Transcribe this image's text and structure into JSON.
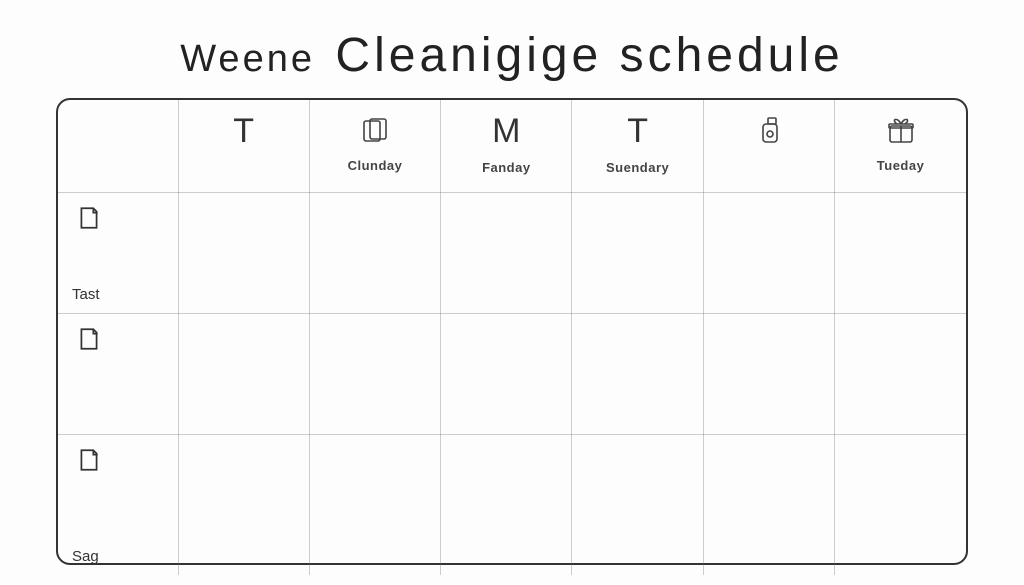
{
  "title": {
    "small": "Weene",
    "big": "Cleanigige schedule"
  },
  "columns": [
    {
      "letter": "",
      "sub": "",
      "icon": "none"
    },
    {
      "letter": "T",
      "sub": "",
      "icon": "letter"
    },
    {
      "letter": "",
      "sub": "Clunday",
      "icon": "card"
    },
    {
      "letter": "M",
      "sub": "Fanday",
      "icon": "letter"
    },
    {
      "letter": "T",
      "sub": "Suendary",
      "icon": "letter"
    },
    {
      "letter": "",
      "sub": "",
      "icon": "bottle"
    },
    {
      "letter": "",
      "sub": "Tueday",
      "icon": "gift"
    }
  ],
  "rows": [
    {
      "label": "Tast",
      "icon": "note"
    },
    {
      "label": "",
      "icon": "note"
    },
    {
      "label": "Sag",
      "icon": "note"
    }
  ]
}
